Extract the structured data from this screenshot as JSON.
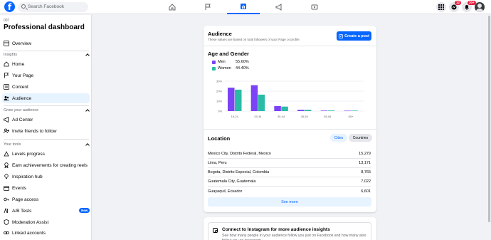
{
  "topbar": {
    "search_placeholder": "Search Facebook",
    "badges": {
      "messenger": "12",
      "notifications": "20+"
    }
  },
  "sidebar": {
    "breadcrumb": "007",
    "title": "Professional dashboard",
    "overview": "Overview",
    "insights_heading": "Insights",
    "insights": [
      "Home",
      "Your Page",
      "Content",
      "Audience"
    ],
    "grow_heading": "Grow your audience",
    "grow": [
      "Ad Center",
      "Invite friends to follow"
    ],
    "tools_heading": "Your tools",
    "tools": [
      "Levels progress",
      "Earn achievements for creating reels",
      "Inspiration hub",
      "Events",
      "Page access",
      "A/B Tests",
      "Moderation Assist",
      "Linked accounts"
    ],
    "new_badge": "New"
  },
  "audience": {
    "title": "Audience",
    "subtitle": "These values are based on total followers of your Page or profile.",
    "create_post": "Create a post",
    "age_gender_title": "Age and Gender",
    "legend": [
      {
        "label": "Men",
        "value": "55.60%",
        "color": "#7b42f6"
      },
      {
        "label": "Women",
        "value": "44.40%",
        "color": "#2abba7"
      }
    ]
  },
  "chart_data": {
    "type": "bar",
    "categories": [
      "18-24",
      "25-34",
      "35-44",
      "45-54",
      "55-64",
      "65+"
    ],
    "series": [
      {
        "name": "Men",
        "values": [
          23.5,
          26,
          5,
          1.3,
          0.5,
          0.4
        ]
      },
      {
        "name": "Women",
        "values": [
          21.5,
          16.5,
          4.5,
          1.3,
          0.6,
          0.5
        ]
      }
    ],
    "yticks": [
      "0%",
      "10%",
      "20%",
      "30%"
    ],
    "ylim": [
      0,
      30
    ],
    "grid": true
  },
  "location": {
    "title": "Location",
    "tab_cities": "Cities",
    "tab_countries": "Countries",
    "rows": [
      {
        "name": "Mexico City, Distrito Federal, Mexico",
        "count": "15,279"
      },
      {
        "name": "Lima, Peru",
        "count": "13,171"
      },
      {
        "name": "Bogota, Distrito Especial, Colombia",
        "count": "8,765"
      },
      {
        "name": "Guatemala City, Guatemala",
        "count": "7,022"
      },
      {
        "name": "Guayaquil, Ecuador",
        "count": "6,601"
      }
    ],
    "see_more": "See more"
  },
  "instagram": {
    "title": "Connect to Instagram for more audience insights",
    "description": "See how many people in your audience follow you just on Facebook and how many also follow you on Instagram."
  }
}
